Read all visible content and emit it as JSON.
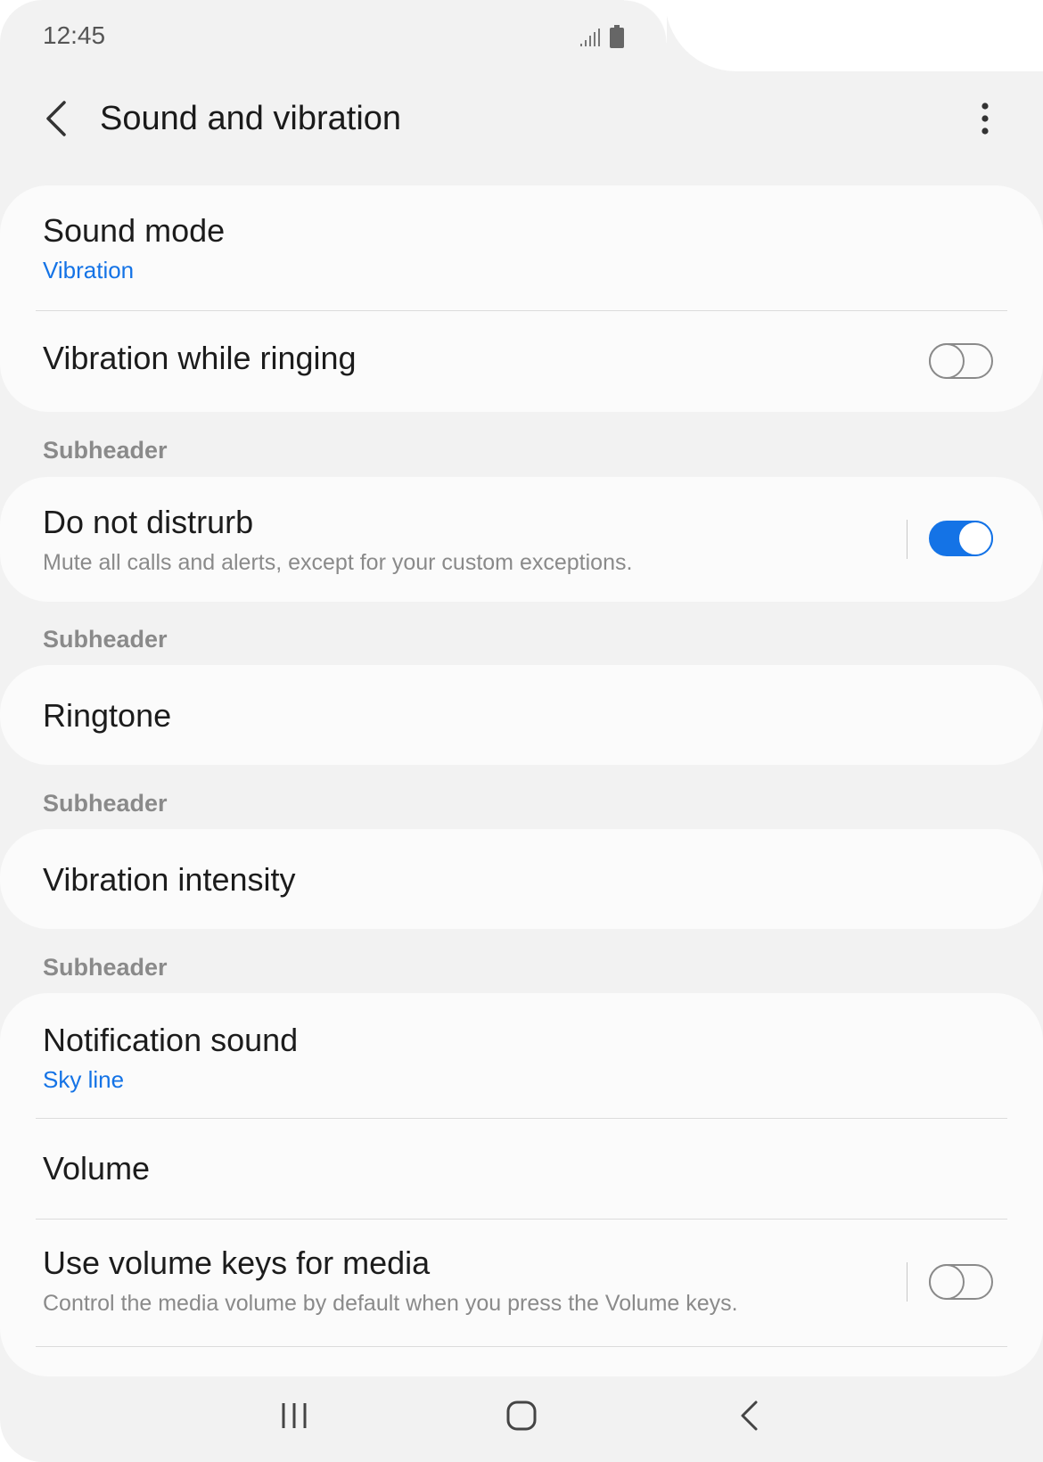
{
  "status_bar": {
    "time": "12:45",
    "icons": [
      "signal-icon",
      "battery-icon"
    ]
  },
  "app_bar": {
    "title": "Sound and vibration",
    "back_icon": "chevron-left-icon",
    "more_icon": "more-vertical-icon"
  },
  "card1": {
    "sound_mode": {
      "title": "Sound mode",
      "value": "Vibration"
    },
    "vibration_while_ringing": {
      "title": "Vibration while ringing",
      "enabled": false
    }
  },
  "subheader1": "Subheader",
  "card2": {
    "do_not_disturb": {
      "title": "Do not distrurb",
      "subtitle": "Mute all calls and alerts, except for your custom exceptions.",
      "enabled": true
    }
  },
  "subheader2": "Subheader",
  "card3": {
    "ringtone": {
      "title": "Ringtone"
    }
  },
  "subheader3": "Subheader",
  "card4": {
    "vibration_intensity": {
      "title": "Vibration intensity"
    }
  },
  "subheader4": "Subheader",
  "card5": {
    "notification_sound": {
      "title": "Notification sound",
      "value": "Sky line"
    },
    "volume": {
      "title": "Volume"
    },
    "use_volume_keys": {
      "title": "Use volume keys for media",
      "subtitle": "Control the media volume by default when you press the Volume keys.",
      "enabled": false
    }
  },
  "nav_bar": {
    "icons": [
      "recent-apps-icon",
      "home-icon",
      "back-icon"
    ]
  },
  "colors": {
    "accent": "#1473e6",
    "background": "#f2f2f2",
    "card": "#fbfbfb"
  }
}
